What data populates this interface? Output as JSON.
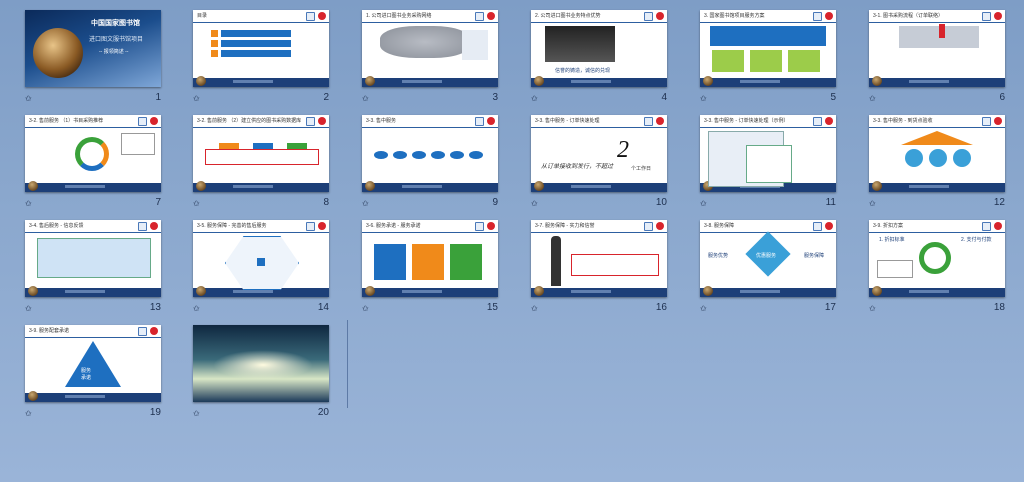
{
  "slides": [
    {
      "num": "1",
      "title": "",
      "t1": "中国国家图书馆",
      "t2": "进口图文服书馆项目",
      "t3": "-- 报领简述 --"
    },
    {
      "num": "2",
      "title": "目录"
    },
    {
      "num": "3",
      "title": "1. 公司进口图书业务采购网络"
    },
    {
      "num": "4",
      "title": "2. 公司进口图书业务特点优势",
      "caption": "信誉的铸造，诚信的兑现"
    },
    {
      "num": "5",
      "title": "3. 国家图书馆项目服务方案"
    },
    {
      "num": "6",
      "title": "3-1. 图书采购流程（订单联络）"
    },
    {
      "num": "7",
      "title": "3-2. 售前服务 （1）书目采购推荐"
    },
    {
      "num": "8",
      "title": "3-2. 售前服务 （2）建立供应的图书采购数据库"
    },
    {
      "num": "9",
      "title": "3-3. 售中服务"
    },
    {
      "num": "10",
      "title": "3-3. 售中服务 - 订单快速处理",
      "c1": "从订单接收到发行，不超过",
      "c2": "2",
      "c3": "个工作日"
    },
    {
      "num": "11",
      "title": "3-3. 售中服务 - 订单快速处理（示例）"
    },
    {
      "num": "12",
      "title": "3-3. 售中服务 - 到货点验收"
    },
    {
      "num": "13",
      "title": "3-4. 售后服务 - 信息反馈"
    },
    {
      "num": "14",
      "title": "3-5. 服务保障 - 完善的售后服务"
    },
    {
      "num": "15",
      "title": "3-6. 服务承诺 - 服务承诺"
    },
    {
      "num": "16",
      "title": "3-7. 服务保障 - 实力和信誉"
    },
    {
      "num": "17",
      "title": "3-8. 服务保障",
      "left": "服务优势",
      "center": "优惠服务",
      "right": "服务保障"
    },
    {
      "num": "18",
      "title": "3-9. 折扣方案",
      "n1": "1. 折扣标准",
      "n2": "2. 支付与付款"
    },
    {
      "num": "19",
      "title": "3-9. 服务配套承诺",
      "tri": "服务\n承诺"
    },
    {
      "num": "20",
      "title": ""
    }
  ],
  "colors": {
    "bg": "#8aa7cd",
    "header_blue": "#2d5fa0",
    "footer": "#1d3f78",
    "accent_red": "#d8242c"
  }
}
